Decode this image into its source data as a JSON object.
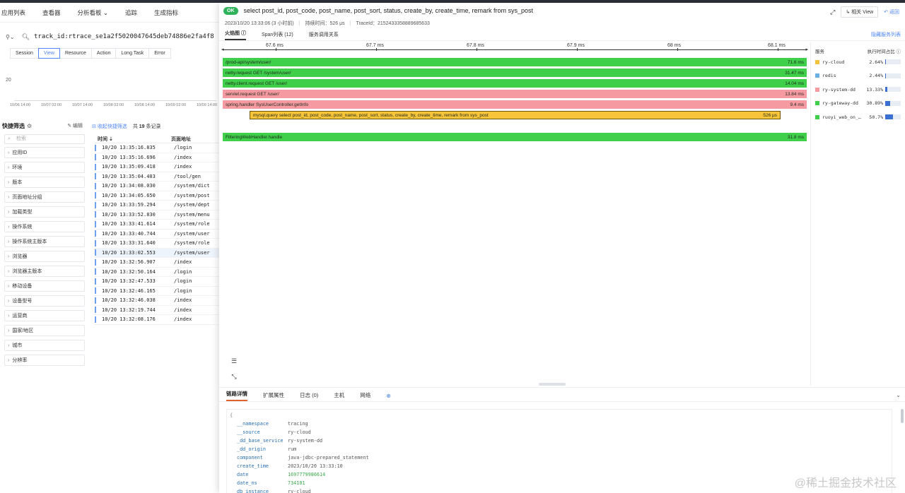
{
  "nav": [
    "应用列表",
    "查看器",
    "分析看板 ⌄",
    "追踪",
    "生成指标"
  ],
  "search": {
    "query": "track_id:rtrace_se1a2f5020047645deb74886e2fa4f8"
  },
  "type_tabs": [
    {
      "label": "Session",
      "active": false
    },
    {
      "label": "View",
      "active": true
    },
    {
      "label": "Resource",
      "active": false
    },
    {
      "label": "Action",
      "active": false
    },
    {
      "label": "Long Task",
      "active": false
    },
    {
      "label": "Error",
      "active": false
    }
  ],
  "mini_chart": {
    "ytick": "20",
    "xticks": [
      "10/06 14:00",
      "10/07 02:00",
      "10/07 14:00",
      "10/08 02:00",
      "10/08 14:00",
      "10/09 02:00",
      "10/09 14:00"
    ]
  },
  "quick_filter": {
    "title": "快捷筛选",
    "edit": "编辑",
    "search_placeholder": "检索",
    "facets": [
      "应用ID",
      "环境",
      "版本",
      "页面地址分组",
      "加载类型",
      "操作系统",
      "操作系统主版本",
      "浏览器",
      "浏览器主版本",
      "移动设备",
      "设备型号",
      "运营商",
      "国家/地区",
      "城市",
      "分辨率"
    ]
  },
  "records": {
    "collapse_label": "收起快捷筛选",
    "count_prefix": "共",
    "count": "19",
    "count_suffix": "条记录",
    "col_time": "时间 ⇣",
    "col_page": "页面地址",
    "rows": [
      {
        "time": "10/20 13:35:16.835",
        "page": "/login"
      },
      {
        "time": "10/20 13:35:16.696",
        "page": "/index"
      },
      {
        "time": "10/20 13:35:09.418",
        "page": "/index"
      },
      {
        "time": "10/20 13:35:04.403",
        "page": "/tool/gen"
      },
      {
        "time": "10/20 13:34:08.030",
        "page": "/system/dict"
      },
      {
        "time": "10/20 13:34:05.650",
        "page": "/system/post"
      },
      {
        "time": "10/20 13:33:59.294",
        "page": "/system/dept"
      },
      {
        "time": "10/20 13:33:52.830",
        "page": "/system/menu"
      },
      {
        "time": "10/20 13:33:41.614",
        "page": "/system/role"
      },
      {
        "time": "10/20 13:33:40.744",
        "page": "/system/user"
      },
      {
        "time": "10/20 13:33:31.640",
        "page": "/system/role"
      },
      {
        "time": "10/20 13:33:02.553",
        "page": "/system/user"
      },
      {
        "time": "10/20 13:32:56.907",
        "page": "/index"
      },
      {
        "time": "10/20 13:32:50.164",
        "page": "/login"
      },
      {
        "time": "10/20 13:32:47.533",
        "page": "/login"
      },
      {
        "time": "10/20 13:32:46.165",
        "page": "/login"
      },
      {
        "time": "10/20 13:32:46.038",
        "page": "/index"
      },
      {
        "time": "10/20 13:32:19.744",
        "page": "/index"
      },
      {
        "time": "10/20 13:32:08.176",
        "page": "/index"
      }
    ]
  },
  "panel": {
    "status": "OK",
    "title": "select post_id, post_code, post_name, post_sort, status, create_by, create_time, remark from sys_post",
    "view_button": "相关 View",
    "back_label": "返回",
    "time": "2023/10/20 13:33:06 (3 小时前)",
    "duration": "持续时间：526 μs",
    "trace_id": "TraceId：2152433358889685633",
    "tabs": [
      "火焰图 ⓘ",
      "Span列表 (12)",
      "服务调用关系"
    ],
    "hide_list": "隐藏服务列表",
    "axis_ticks": [
      "67.6 ms",
      "67.7 ms",
      "67.8 ms",
      "67.9 ms",
      "68 ms",
      "68.1 ms"
    ],
    "spans": [
      {
        "name": "/prod-api/system/user/",
        "dur": "71.6 ms",
        "color": "green"
      },
      {
        "name": "netty.request GET /system/user/",
        "dur": "31.47 ms",
        "color": "green"
      },
      {
        "name": "netty.client.request GET /user/",
        "dur": "14.04 ms",
        "color": "green"
      },
      {
        "name": "servlet.request GET /user/",
        "dur": "13.84 ms",
        "color": "pink"
      },
      {
        "name": "spring.handler SysUserController.getInfo",
        "dur": "9.4 ms",
        "color": "pink"
      },
      {
        "name": "mysql.query select post_id, post_code, post_name, post_sort, status, create_by, create_time, remark    from sys_post",
        "dur": "526 μs",
        "color": "yellow"
      },
      {
        "name": "FilteringWebHandler.handle",
        "dur": "31.8 ms",
        "color": "green"
      }
    ],
    "services_head": {
      "name": "服务",
      "pct": "执行时间占比 ⓘ"
    },
    "services": [
      {
        "name": "ry-cloud",
        "pct": "2.64%",
        "value": 2.64,
        "color": "#f5c33b"
      },
      {
        "name": "redis",
        "pct": "2.44%",
        "value": 2.44,
        "color": "#6ab0e0"
      },
      {
        "name": "ry-system-dd",
        "pct": "13.33%",
        "value": 13.33,
        "color": "#f59aa0"
      },
      {
        "name": "ry-gateway-dd",
        "pct": "30.89%",
        "value": 30.89,
        "color": "#3fcf4a"
      },
      {
        "name": "ruoyi_web_on_…",
        "pct": "50.7%",
        "value": 50.7,
        "color": "#3fcf4a"
      }
    ]
  },
  "detail": {
    "tabs": [
      "链路详情",
      "扩展属性",
      "日志 (0)",
      "主机",
      "网络"
    ],
    "fields": [
      {
        "k": "__namespace",
        "v": "tracing"
      },
      {
        "k": "__source",
        "v": "ry-cloud"
      },
      {
        "k": "_dd_base_service",
        "v": "ry-system-dd"
      },
      {
        "k": "_dd_origin",
        "v": "rum"
      },
      {
        "k": "component",
        "v": "java-jdbc-prepared_statement"
      },
      {
        "k": "create_time",
        "v": "2023/10/20 13:33:10"
      },
      {
        "k": "date",
        "v": "1697779986614",
        "num": true
      },
      {
        "k": "date_ns",
        "v": "734101",
        "num": true
      },
      {
        "k": "db_instance",
        "v": "ry-cloud"
      }
    ]
  },
  "watermark": "@稀土掘金技术社区"
}
